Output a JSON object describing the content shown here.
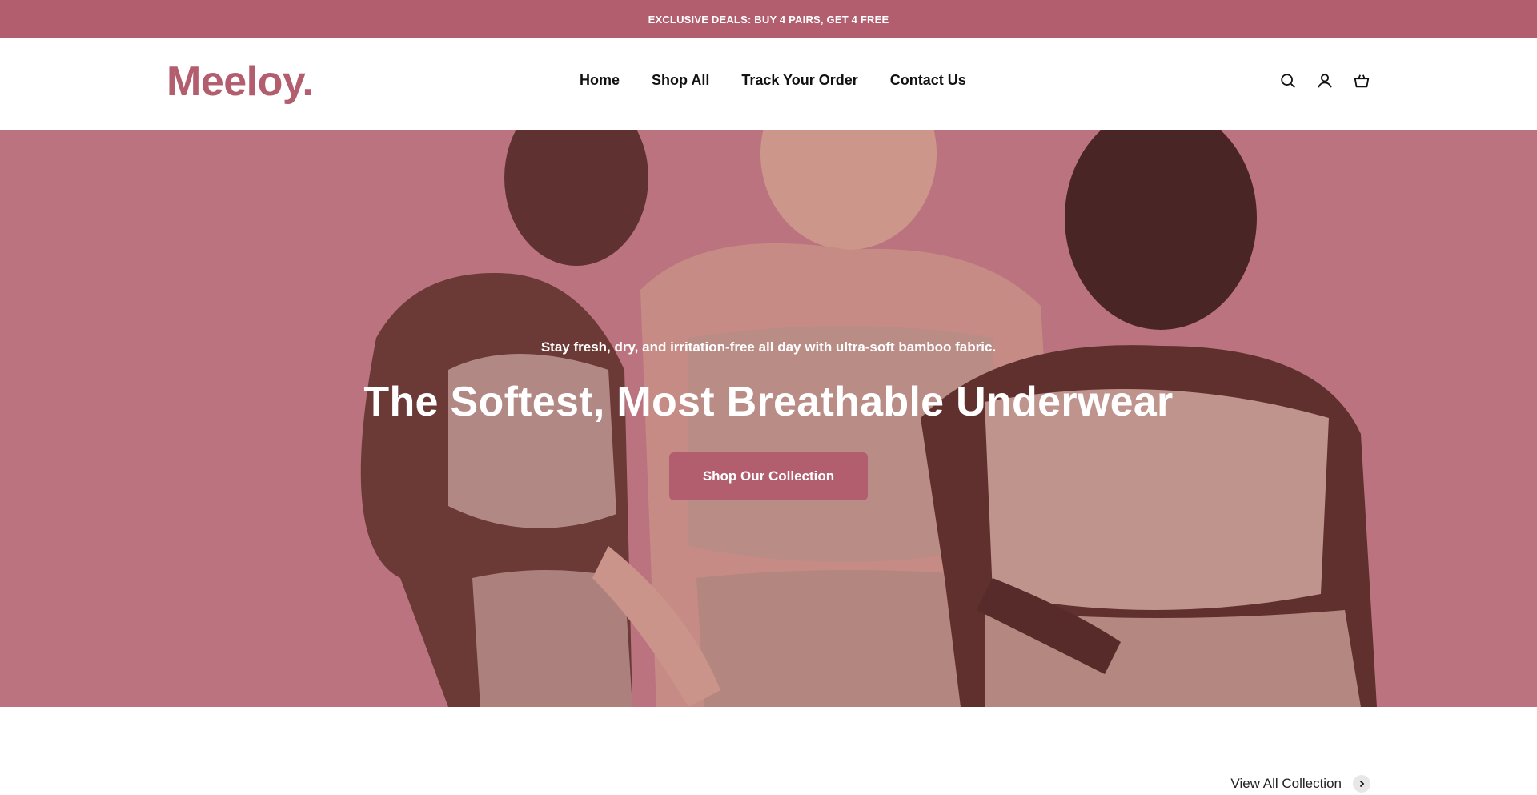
{
  "announcement": {
    "text": "EXCLUSIVE DEALS: BUY 4 PAIRS, GET 4 FREE"
  },
  "header": {
    "logo": "Meeloy.",
    "nav": [
      {
        "label": "Home"
      },
      {
        "label": "Shop All"
      },
      {
        "label": "Track Your Order"
      },
      {
        "label": "Contact Us"
      }
    ],
    "icons": [
      "search-icon",
      "account-icon",
      "cart-icon"
    ]
  },
  "hero": {
    "subtitle": "Stay fresh, dry, and irritation-free all day with ultra-soft bamboo fabric.",
    "title": "The Softest, Most Breathable Underwear",
    "button": "Shop Our Collection"
  },
  "collection": {
    "view_all": "View All Collection"
  },
  "colors": {
    "accent": "#b35e6e",
    "hero_bg": "#c98a93"
  }
}
